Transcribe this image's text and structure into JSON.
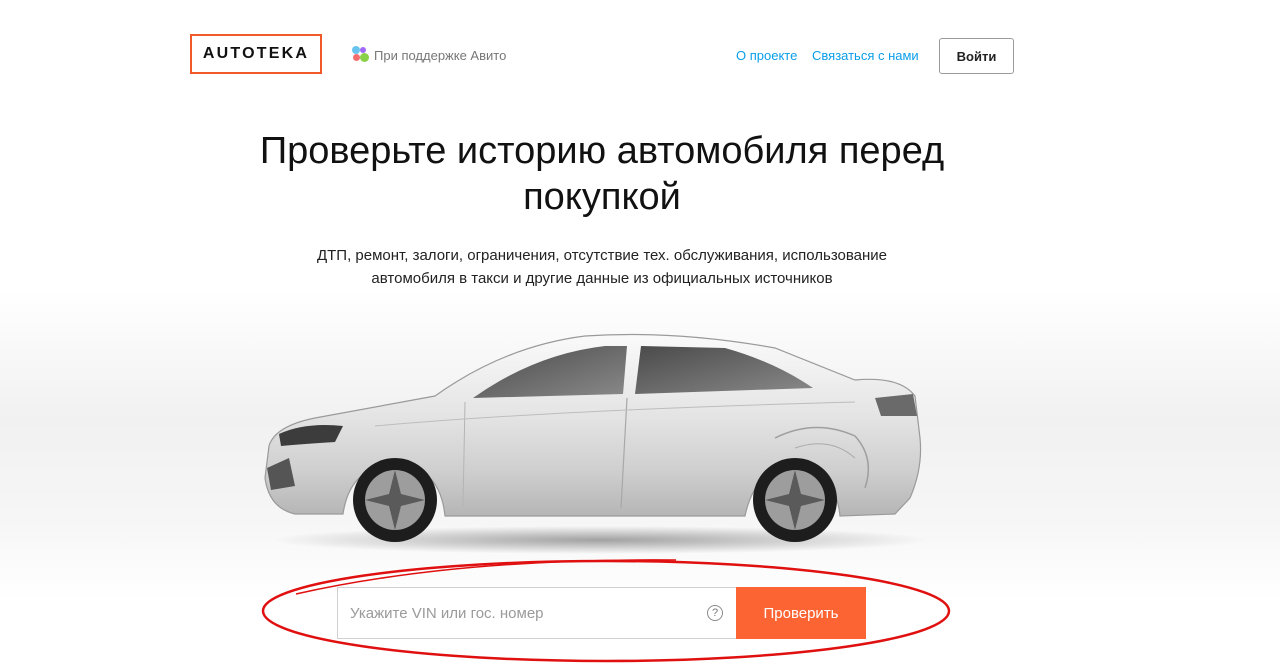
{
  "header": {
    "logo_text": "AUTOTEKA",
    "support_text": "При поддержке Авито",
    "nav": [
      {
        "label": "О проекте"
      },
      {
        "label": "Связаться с нами"
      }
    ],
    "login_label": "Войти"
  },
  "hero": {
    "title": "Проверьте историю автомобиля перед покупкой",
    "subtitle": "ДТП, ремонт, залоги, ограничения, отсутствие тех. обслуживания, использование автомобиля в такси и другие данные из официальных источников"
  },
  "search": {
    "placeholder": "Укажите VIN или гос. номер",
    "value": "",
    "help_symbol": "?",
    "submit_label": "Проверить"
  },
  "colors": {
    "brand_orange": "#fd6434",
    "logo_border": "#f05a28",
    "link_blue": "#0a9ee8",
    "annotation_red": "#e01010"
  },
  "icons": [
    "avito-logo-icon",
    "help-icon"
  ]
}
